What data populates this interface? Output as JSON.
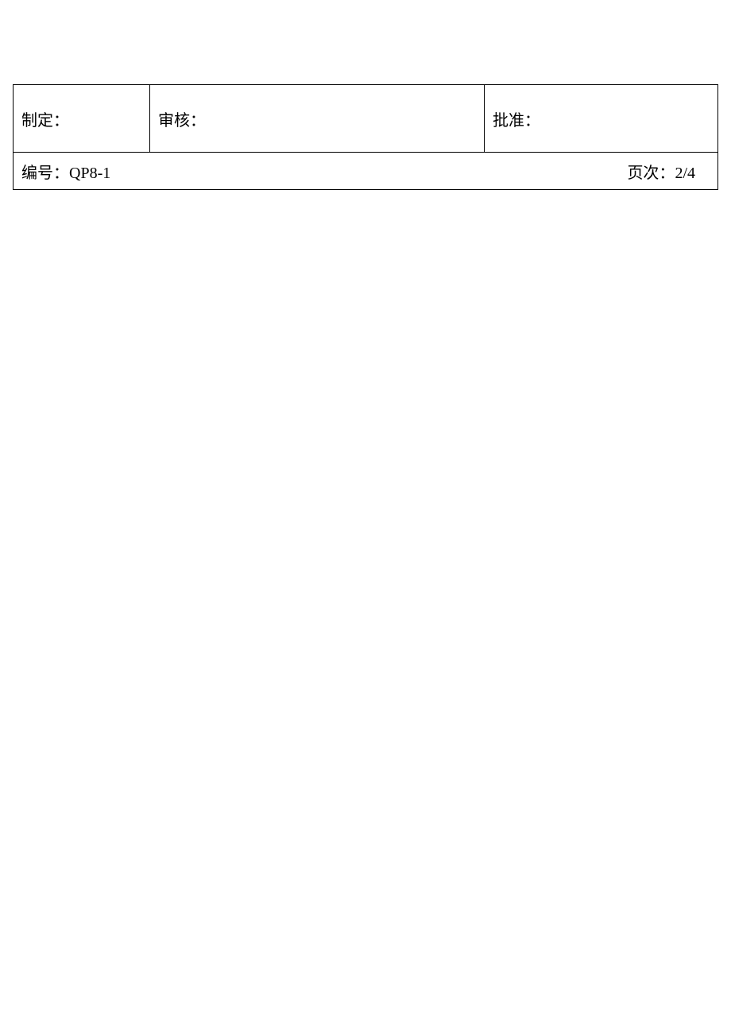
{
  "signoff": {
    "prepared_label": "制定：",
    "reviewed_label": "审核：",
    "approved_label": "批准："
  },
  "footer": {
    "doc_no_label": "编号：",
    "doc_no_value": "QP8-1",
    "page_label": "页次：",
    "page_value": "2/4"
  }
}
